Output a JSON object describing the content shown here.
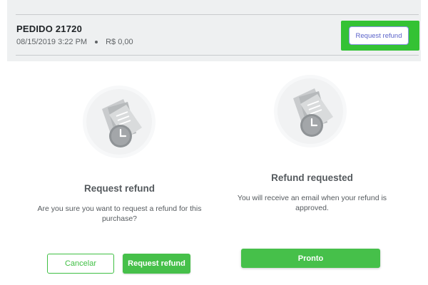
{
  "order": {
    "title": "PEDIDO 21720",
    "date": "08/15/2019 3:22 PM",
    "amount": "R$ 0,00",
    "refund_button": "Request refund"
  },
  "confirm_panel": {
    "icon": "refund-receipt-clock-icon",
    "title": "Request refund",
    "message": "Are you sure you want to request a refund for this purchase?",
    "cancel_label": "Cancelar",
    "confirm_label": "Request refund"
  },
  "success_panel": {
    "icon": "refund-receipt-clock-icon",
    "title": "Refund requested",
    "message": "You will receive an email when your refund is approved.",
    "done_label": "Pronto"
  },
  "colors": {
    "accent_green": "#46c04a",
    "highlight_green": "#34c234",
    "header_bg": "#eef0f1",
    "link_blue": "#5a62c9"
  }
}
